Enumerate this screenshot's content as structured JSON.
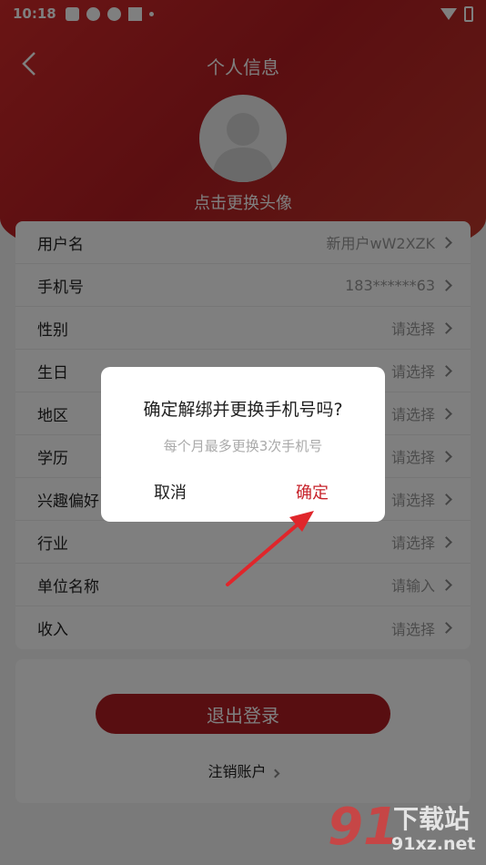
{
  "status_bar": {
    "time": "10:18"
  },
  "nav": {
    "title": "个人信息"
  },
  "avatar": {
    "hint": "点击更换头像"
  },
  "profile_rows": [
    {
      "label": "用户名",
      "value": "新用户wW2XZK"
    },
    {
      "label": "手机号",
      "value": "183******63"
    },
    {
      "label": "性别",
      "value": "请选择"
    },
    {
      "label": "生日",
      "value": "请选择"
    },
    {
      "label": "地区",
      "value": "请选择"
    },
    {
      "label": "学历",
      "value": "请选择"
    },
    {
      "label": "兴趣偏好",
      "value": "请选择"
    },
    {
      "label": "行业",
      "value": "请选择"
    },
    {
      "label": "单位名称",
      "value": "请输入"
    },
    {
      "label": "收入",
      "value": "请选择"
    }
  ],
  "account": {
    "logout_label": "退出登录",
    "cancel_account_label": "注销账户"
  },
  "dialog": {
    "title": "确定解绑并更换手机号吗?",
    "subtitle": "每个月最多更换3次手机号",
    "cancel_label": "取消",
    "ok_label": "确定"
  },
  "watermark": {
    "text": "下载站",
    "url": "91xz.net",
    "mark": "91"
  },
  "colors": {
    "accent": "#b01c22",
    "header": "#d42a2a",
    "ok": "#c7222a",
    "arrow": "#e0262b"
  }
}
